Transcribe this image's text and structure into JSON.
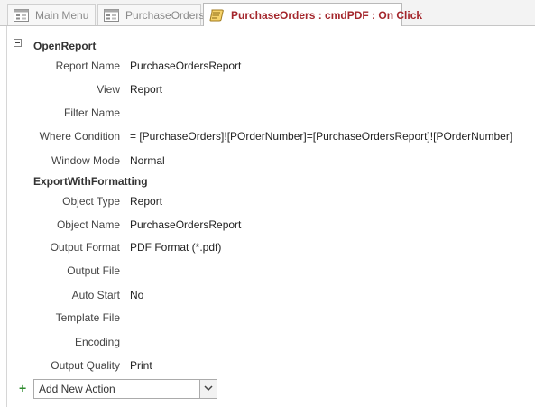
{
  "tabs": [
    {
      "label": "Main Menu",
      "icon": "form-icon",
      "active": false
    },
    {
      "label": "PurchaseOrders",
      "icon": "form-icon",
      "active": false
    },
    {
      "label": "PurchaseOrders : cmdPDF : On Click",
      "icon": "macro-icon",
      "active": true
    }
  ],
  "actions": [
    {
      "name": "OpenReport",
      "args": [
        {
          "label": "Report Name",
          "value": "PurchaseOrdersReport"
        },
        {
          "label": "View",
          "value": "Report"
        },
        {
          "label": "Filter Name",
          "value": ""
        },
        {
          "label": "Where Condition",
          "value": "= [PurchaseOrders]![POrderNumber]=[PurchaseOrdersReport]![POrderNumber]"
        },
        {
          "label": "Window Mode",
          "value": "Normal"
        }
      ]
    },
    {
      "name": "ExportWithFormatting",
      "args": [
        {
          "label": "Object Type",
          "value": "Report"
        },
        {
          "label": "Object Name",
          "value": "PurchaseOrdersReport"
        },
        {
          "label": "Output Format",
          "value": "PDF Format (*.pdf)"
        },
        {
          "label": "Output File",
          "value": ""
        },
        {
          "label": "Auto Start",
          "value": "No"
        },
        {
          "label": "Template File",
          "value": ""
        },
        {
          "label": "Encoding",
          "value": ""
        },
        {
          "label": "Output Quality",
          "value": "Print"
        }
      ]
    }
  ],
  "add_action": {
    "plus": "+",
    "value": "Add New Action"
  },
  "colors": {
    "active_tab_text": "#a4262c",
    "plus_green": "#2e8b2e"
  }
}
